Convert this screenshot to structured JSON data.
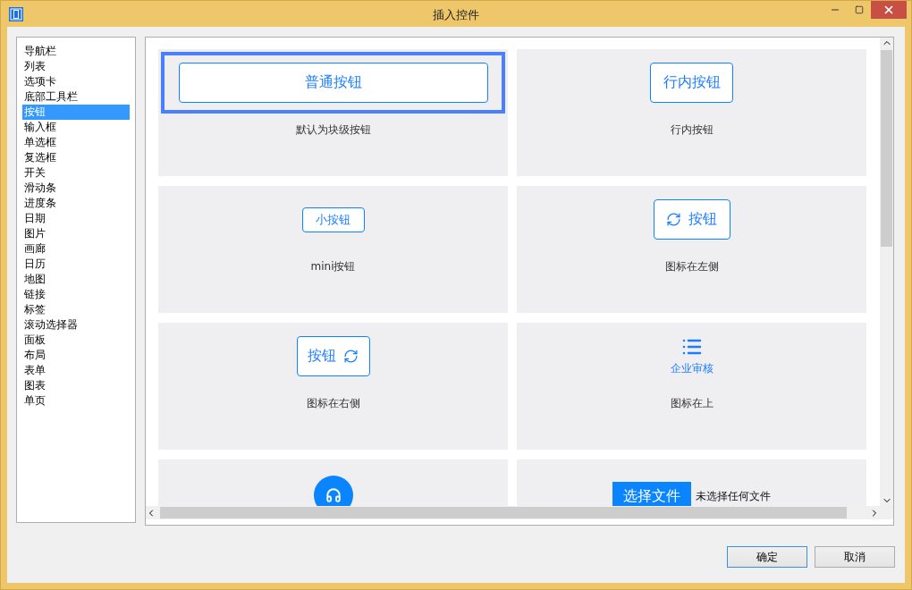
{
  "window": {
    "title": "插入控件"
  },
  "sidebar": {
    "items": [
      {
        "label": "导航栏",
        "selected": false
      },
      {
        "label": "列表",
        "selected": false
      },
      {
        "label": "选项卡",
        "selected": false
      },
      {
        "label": "底部工具栏",
        "selected": false
      },
      {
        "label": "按钮",
        "selected": true
      },
      {
        "label": "输入框",
        "selected": false
      },
      {
        "label": "单选框",
        "selected": false
      },
      {
        "label": "复选框",
        "selected": false
      },
      {
        "label": "开关",
        "selected": false
      },
      {
        "label": "滑动条",
        "selected": false
      },
      {
        "label": "进度条",
        "selected": false
      },
      {
        "label": "日期",
        "selected": false
      },
      {
        "label": "图片",
        "selected": false
      },
      {
        "label": "画廊",
        "selected": false
      },
      {
        "label": "日历",
        "selected": false
      },
      {
        "label": "地图",
        "selected": false
      },
      {
        "label": "链接",
        "selected": false
      },
      {
        "label": "标签",
        "selected": false
      },
      {
        "label": "滚动选择器",
        "selected": false
      },
      {
        "label": "面板",
        "selected": false
      },
      {
        "label": "布局",
        "selected": false
      },
      {
        "label": "表单",
        "selected": false
      },
      {
        "label": "图表",
        "selected": false
      },
      {
        "label": "单页",
        "selected": false
      }
    ]
  },
  "cards": [
    {
      "kind": "block",
      "button": "普通按钮",
      "caption": "默认为块级按钮",
      "selected": true
    },
    {
      "kind": "inline",
      "button": "行内按钮",
      "caption": "行内按钮",
      "selected": false
    },
    {
      "kind": "mini",
      "button": "小按钮",
      "caption": "mini按钮",
      "selected": false
    },
    {
      "kind": "icon-left",
      "button": "按钮",
      "caption": "图标在左侧",
      "selected": false
    },
    {
      "kind": "icon-right",
      "button": "按钮",
      "caption": "图标在右侧",
      "selected": false
    },
    {
      "kind": "icon-top",
      "button": "企业审核",
      "caption": "图标在上",
      "selected": false
    },
    {
      "kind": "round-icon",
      "selected": false
    },
    {
      "kind": "file",
      "button": "选择文件",
      "status": "未选择任何文件",
      "selected": false
    }
  ],
  "buttons": [
    {
      "label": "确定",
      "default": true
    },
    {
      "label": "取消",
      "default": false
    }
  ]
}
